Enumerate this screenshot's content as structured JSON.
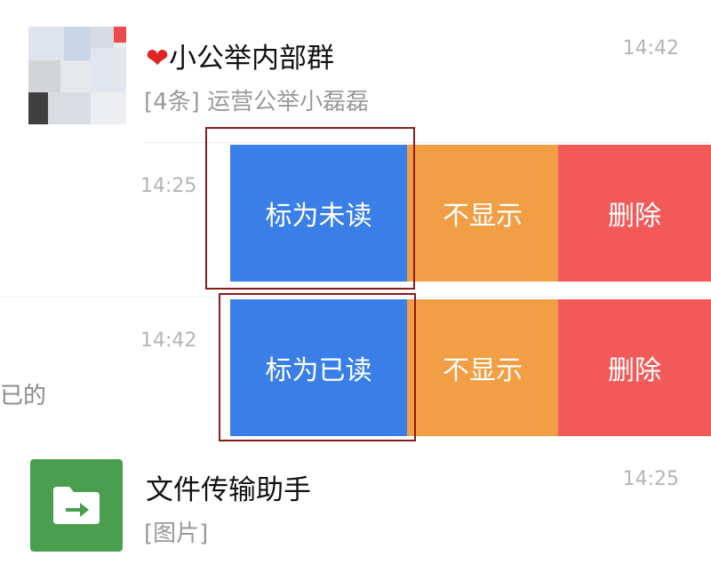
{
  "chats": [
    {
      "name_heart": "❤",
      "name": "小公举内部群",
      "preview": "[4条] 运营公举小磊磊",
      "time": "14:42"
    },
    {
      "time": "14:25",
      "actions": {
        "mark_unread": "标为未读",
        "hide": "不显示",
        "delete": "删除"
      }
    },
    {
      "time": "14:42",
      "preview_cut": "已的",
      "actions": {
        "mark_read": "标为已读",
        "hide": "不显示",
        "delete": "删除"
      }
    },
    {
      "name": "文件传输助手",
      "preview": "[图片]",
      "time": "14:25",
      "avatar_icon": "folder-arrow-icon"
    }
  ],
  "colors": {
    "mark_button": "#3a7fe8",
    "hide_button": "#f19e45",
    "delete_button": "#f25a5a",
    "highlight_box": "#8a1c1c",
    "file_helper_avatar": "#4a9e50"
  }
}
